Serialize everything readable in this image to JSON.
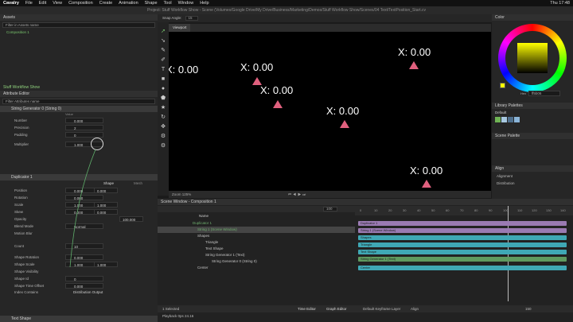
{
  "menubar": {
    "app": "Cavalry",
    "items": [
      "File",
      "Edit",
      "View",
      "Composition",
      "Create",
      "Animation",
      "Shape",
      "Tool",
      "Window",
      "Help"
    ],
    "clock": "Thu 17:48"
  },
  "titlebar": {
    "text": "Project: Stuff Workflow Show - Scene (Volumes/Google Drive/My Drive/Business/Marketing/Demos/Stuff Workflow Show/Scenes/04 Text/TextPosition_Start.cv"
  },
  "toolbar": {
    "snap_label": "Snap Angle:",
    "snap_value": "15"
  },
  "assets": {
    "title": "Assets",
    "search_placeholder": "Filter in Assets name",
    "item": "Composition 1"
  },
  "attribute_editor": {
    "header": "Stuff Workflow Show",
    "title": "Attribute Editor",
    "search_placeholder": "Filter Attributes name",
    "node1": "String Generator 0 (String 0)",
    "node1_tab": "Value",
    "node1_rows": [
      {
        "label": "Number",
        "value": "0.000"
      },
      {
        "label": "Precision",
        "value": "2"
      },
      {
        "label": "Padding",
        "value": "0"
      },
      {
        "label": "Multiplier",
        "value": "1.000"
      }
    ],
    "node2": "Duplicator 1",
    "node2_tabs": [
      "Shape",
      "Mesh"
    ],
    "node2_rows": [
      {
        "label": "Position",
        "value": "0.000",
        "value2": "0.000"
      },
      {
        "label": "Rotation",
        "value": "0.000",
        "value2": ""
      },
      {
        "label": "Scale",
        "value": "1.000",
        "value2": "1.000"
      },
      {
        "label": "Skew",
        "value": "0.000",
        "value2": "0.000"
      },
      {
        "label": "Opacity",
        "value": "",
        "value2": "100.000"
      },
      {
        "label": "Blend Mode",
        "value": "Normal",
        "value2": ""
      },
      {
        "label": "Motion Blur",
        "value": "",
        "value2": ""
      },
      {
        "label": "Count",
        "value": "10",
        "value2": ""
      },
      {
        "label": "Shape Rotation",
        "value": "0.000",
        "value2": ""
      },
      {
        "label": "Shape Scale",
        "value": "1.000",
        "value2": "1.000"
      },
      {
        "label": "Shape Visibility",
        "value": "",
        "value2": ""
      },
      {
        "label": "Shape Id",
        "value": "0",
        "value2": ""
      },
      {
        "label": "Shape Time Offset",
        "value": "0.000",
        "value2": ""
      },
      {
        "label": "Index Contains",
        "value": "Distribution Output",
        "value2": ""
      }
    ],
    "footer": "Text Shape"
  },
  "viewport": {
    "tab": "Viewport",
    "labels": [
      "X: 0.00",
      "X: 0.00",
      "X: 0.00",
      "X: 0.00",
      "X: 0.00",
      "X: 0.00"
    ],
    "zoom_label": "Zoom",
    "zoom_value": "125%"
  },
  "scene_window": {
    "title": "Scene Window - Composition 1",
    "column": "Name",
    "frame_value": "100",
    "rows": [
      "Duplicator 1",
      "String 1 (Scene Window)",
      "Shapes",
      "Triangle",
      "Text Shape",
      "String Generator 1 (Text)",
      "String Generator 0 (String 0)",
      "Center"
    ],
    "status": "1 Selected",
    "buttons": [
      "Time Editor",
      "Graph Editor"
    ],
    "playback": "Playback 0ps 24.16"
  },
  "timeline": {
    "ruler": [
      "0",
      "10",
      "20",
      "30",
      "40",
      "50",
      "60",
      "70",
      "80",
      "90",
      "100",
      "110",
      "120",
      "130",
      "140"
    ],
    "tracks": [
      "Duplicator 1",
      "String 1 (Scene Window)",
      "Shapes",
      "Triangle",
      "Text Shape",
      "String Generator 1 (Text)",
      "Center"
    ],
    "footer_left": "Default Keyframe Layer",
    "footer_align": "Align",
    "frame_end": "150"
  },
  "color_panel": {
    "title": "Color",
    "hex_label": "Hex",
    "hex_value": "ff5b06",
    "library_title": "Library Palettes",
    "default_label": "Default",
    "scene_palette": "Scene Palette",
    "swatches": [
      "#6fb354",
      "#a7c8e0",
      "#4e6e8c",
      "#8ab4d8"
    ],
    "wheel_accent": "#ffff00"
  },
  "align_panel": {
    "title": "Align",
    "rows": [
      "Alignment",
      "Distribution"
    ]
  }
}
